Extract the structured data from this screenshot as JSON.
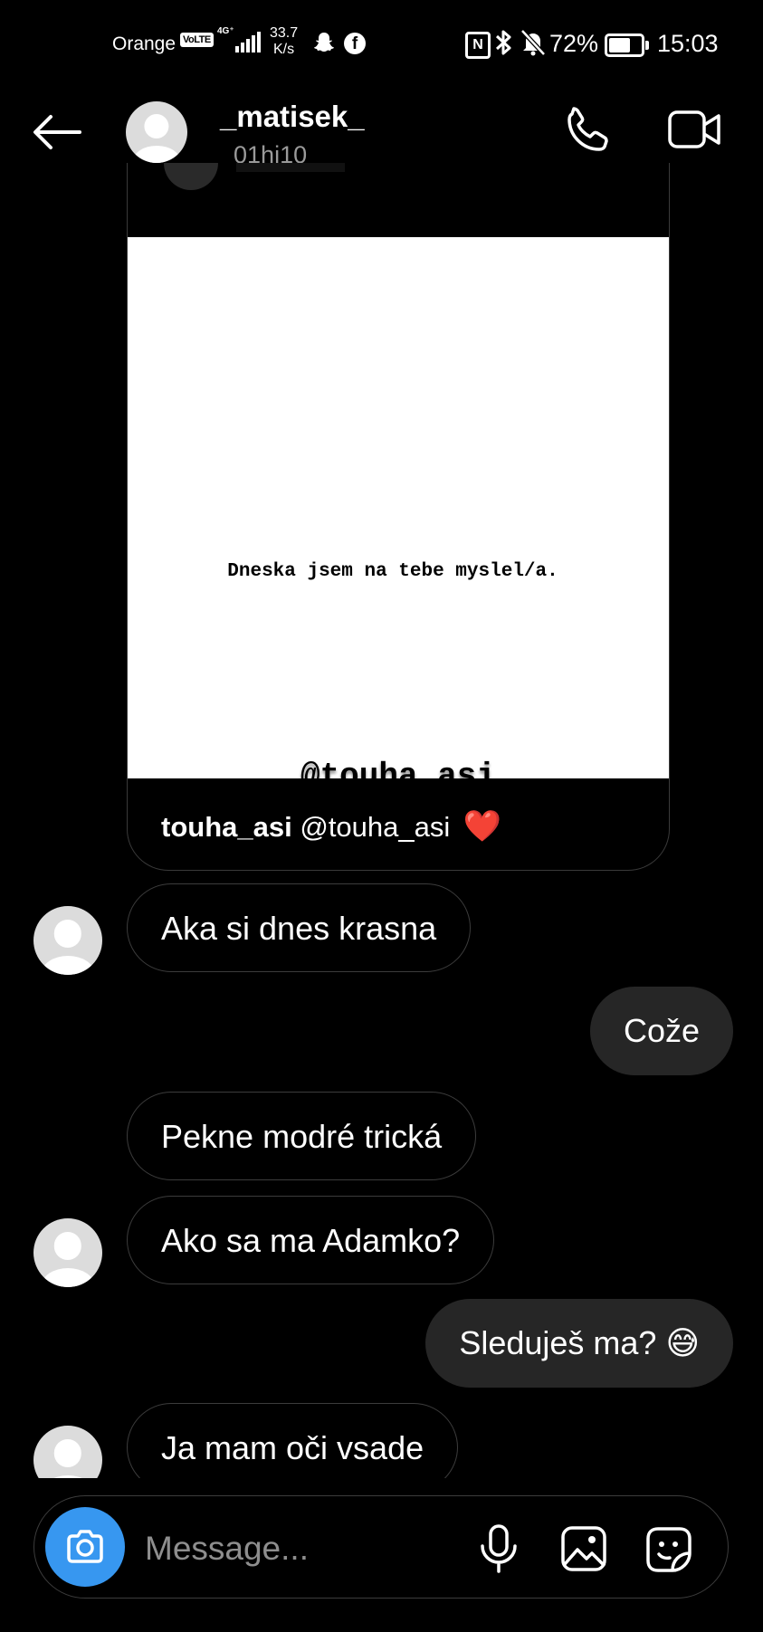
{
  "status_bar": {
    "carrier": "Orange",
    "volte": "VoLTE",
    "network": "4G⁺",
    "speed_value": "33.7",
    "speed_unit": "K/s",
    "nfc": "N",
    "battery": "72%",
    "battery_level": 0.72,
    "time": "15:03"
  },
  "header": {
    "display_name": "_matisek_",
    "username": "_01hi10_"
  },
  "shared_story": {
    "text": "Dneska jsem na tebe myslel/a.",
    "mention": "@touha_asi",
    "caption_user": "touha_asi",
    "caption_text": "@touha_asi",
    "caption_emoji": "❤️"
  },
  "messages": [
    {
      "direction": "in",
      "text": "Aka si dnes krasna"
    },
    {
      "direction": "out",
      "text": "Cože"
    },
    {
      "direction": "in",
      "text": "Pekne modré trická"
    },
    {
      "direction": "in",
      "text": "Ako sa ma Adamko?"
    },
    {
      "direction": "out",
      "text": "Sleduješ ma? 😅"
    },
    {
      "direction": "in",
      "text": "Ja mam oči vsade"
    }
  ],
  "composer": {
    "placeholder": "Message..."
  },
  "colors": {
    "background": "#000000",
    "outgoing_bubble": "#262626",
    "incoming_border": "#3c3c3c",
    "camera_button": "#3797f0",
    "muted_text": "#9a9a9a"
  }
}
